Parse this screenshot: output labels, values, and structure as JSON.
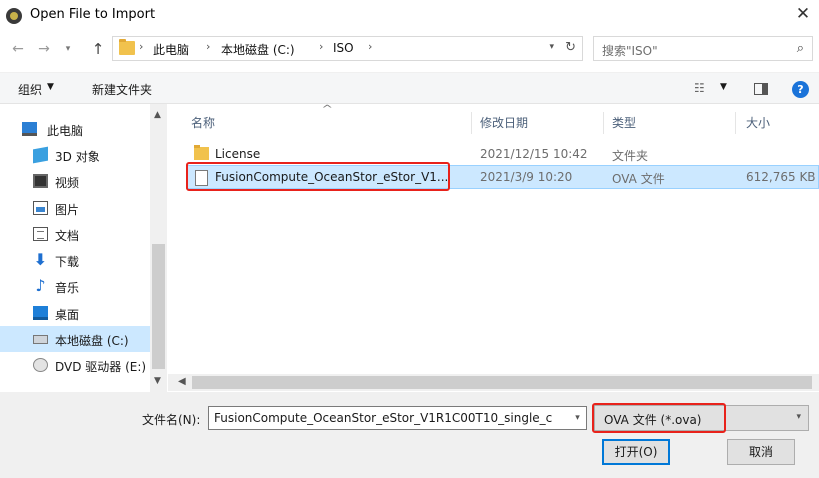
{
  "window": {
    "title": "Open File to Import",
    "close_glyph": "✕"
  },
  "address": {
    "breadcrumbs": [
      "此电脑",
      "本地磁盘 (C:)",
      "ISO"
    ],
    "separator": "›",
    "search_placeholder": "搜索\"ISO\""
  },
  "toolbar": {
    "organize_label": "组织",
    "new_folder_label": "新建文件夹"
  },
  "nav_pane": {
    "items": [
      {
        "label": "此电脑",
        "icon": "computer-icon"
      },
      {
        "label": "3D 对象",
        "icon": "3d-objects-icon"
      },
      {
        "label": "视频",
        "icon": "video-icon"
      },
      {
        "label": "图片",
        "icon": "pictures-icon"
      },
      {
        "label": "文档",
        "icon": "documents-icon"
      },
      {
        "label": "下载",
        "icon": "download-icon"
      },
      {
        "label": "音乐",
        "icon": "music-icon"
      },
      {
        "label": "桌面",
        "icon": "desktop-icon"
      },
      {
        "label": "本地磁盘 (C:)",
        "icon": "drive-icon",
        "selected": true
      },
      {
        "label": "DVD 驱动器 (E:)",
        "icon": "dvd-icon"
      }
    ]
  },
  "file_list": {
    "columns": [
      "名称",
      "修改日期",
      "类型",
      "大小"
    ],
    "rows": [
      {
        "name": "License",
        "modified": "2021/12/15 10:42",
        "type": "文件夹",
        "size": "",
        "icon": "folder-icon"
      },
      {
        "name": "FusionCompute_OceanStor_eStor_V1...",
        "modified": "2021/3/9 10:20",
        "type": "OVA 文件",
        "size": "612,765 KB",
        "icon": "file-icon",
        "selected": true
      }
    ]
  },
  "bottom": {
    "filename_label": "文件名(N):",
    "filename_value": "FusionCompute_OceanStor_eStor_V1R1C00T10_single_c",
    "filetype_value": "OVA 文件 (*.ova)",
    "open_button": "打开(O)",
    "cancel_button": "取消"
  },
  "colors": {
    "selection": "#cce8ff",
    "highlight_annotation": "#e8221b",
    "accent": "#0078d7"
  }
}
